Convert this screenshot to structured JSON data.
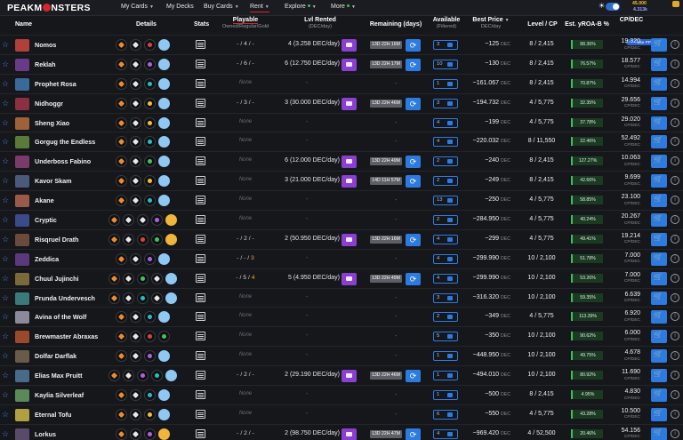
{
  "nav": {
    "logo_pre": "PEAKM",
    "logo_post": "NSTERS",
    "items": [
      "My Cards",
      "My Decks",
      "Buy Cards",
      "Rent",
      "Explore",
      "More"
    ],
    "balance_main": "45.000",
    "balance_sub": "4.313k",
    "use_pp": "Use PP"
  },
  "header": {
    "name": "Name",
    "details": "Details",
    "stats": "Stats",
    "playable": "Playable",
    "playable_sub": "Owned/Regular/Gold",
    "lvl_rented": "Lvl Rented",
    "lvl_rented_sub": "(DEC/day)",
    "remaining": "Remaining (days)",
    "available": "Available",
    "available_sub": "(Filtered)",
    "best_price": "Best Price",
    "best_price_sub": "DEC/day",
    "level_cp": "Level / CP",
    "yroa": "Est. yROA-B %",
    "cp_dec": "CP/DEC"
  },
  "colors": {
    "accent": "#2d7be0",
    "brand": "#d7262b",
    "purple": "#8a3fd0",
    "green": "#3fbf5b"
  },
  "rows": [
    {
      "name": "Nomos",
      "thumb": "#b0403a",
      "icons": [
        "orange",
        "white",
        "red",
        "sky"
      ],
      "playable": "- / 4 / -",
      "lvl": "4 (3.258 DEC/day)",
      "rem": "13D 22H 16M",
      "avail": "3",
      "price": "~125",
      "level_cp": "8 / 2,415",
      "roa": "88.36%",
      "cp": "19.320"
    },
    {
      "name": "Reklah",
      "thumb": "#6a3a8a",
      "icons": [
        "orange",
        "white",
        "purple",
        "sky"
      ],
      "playable": "- / 6 / -",
      "lvl": "6 (12.750 DEC/day)",
      "rem": "13D 22H 17M",
      "avail": "10",
      "price": "~130",
      "level_cp": "8 / 2,415",
      "roa": "76.57%",
      "cp": "18.577"
    },
    {
      "name": "Prophet Rosa",
      "thumb": "#3a6a9a",
      "icons": [
        "orange",
        "white",
        "teal",
        "sky"
      ],
      "playable": "None",
      "lvl": "-",
      "rem": "-",
      "avail": "1",
      "price": "~161.067",
      "level_cp": "8 / 2,415",
      "roa": "70.87%",
      "cp": "14.994"
    },
    {
      "name": "Nidhoggr",
      "thumb": "#8a3040",
      "icons": [
        "orange",
        "white",
        "yellow",
        "sky"
      ],
      "playable": "- / 3 / -",
      "lvl": "3 (30.000 DEC/day)",
      "rem": "13D 22H 46M",
      "avail": "3",
      "price": "~194.732",
      "level_cp": "4 / 5,775",
      "roa": "32.35%",
      "cp": "29.656"
    },
    {
      "name": "Sheng Xiao",
      "thumb": "#a0603a",
      "icons": [
        "orange",
        "white",
        "yellow",
        "sky"
      ],
      "playable": "None",
      "lvl": "-",
      "rem": "-",
      "avail": "4",
      "price": "~199",
      "level_cp": "4 / 5,775",
      "roa": "37.78%",
      "cp": "29.020"
    },
    {
      "name": "Gorgug the Endless",
      "thumb": "#5a7a3a",
      "icons": [
        "orange",
        "white",
        "teal",
        "sky"
      ],
      "playable": "None",
      "lvl": "-",
      "rem": "-",
      "avail": "4",
      "price": "~220.032",
      "level_cp": "8 / 11,550",
      "roa": "22.46%",
      "cp": "52.492"
    },
    {
      "name": "Underboss Fabino",
      "thumb": "#7a3a6a",
      "icons": [
        "orange",
        "white",
        "green",
        "sky"
      ],
      "playable": "None",
      "lvl": "6 (12.000 DEC/day)",
      "rem": "13D 22H 49M",
      "avail": "2",
      "price": "~240",
      "level_cp": "8 / 2,415",
      "roa": "127.27%",
      "cp": "10.063"
    },
    {
      "name": "Kavor Skam",
      "thumb": "#4a5a7a",
      "icons": [
        "orange",
        "white",
        "yellow",
        "sky"
      ],
      "playable": "None",
      "lvl": "3 (21.000 DEC/day)",
      "rem": "14D 11H 57M",
      "avail": "2",
      "price": "~249",
      "level_cp": "8 / 2,415",
      "roa": "42.66%",
      "cp": "9.699"
    },
    {
      "name": "Akane",
      "thumb": "#9a5a4a",
      "icons": [
        "orange",
        "white",
        "teal",
        "sky"
      ],
      "playable": "None",
      "lvl": "-",
      "rem": "-",
      "avail": "13",
      "price": "~250",
      "level_cp": "4 / 5,775",
      "roa": "58.85%",
      "cp": "23.100"
    },
    {
      "name": "Cryptic",
      "thumb": "#3a4a8a",
      "icons": [
        "orange",
        "white",
        "white",
        "purple",
        "gold"
      ],
      "playable": "None",
      "lvl": "-",
      "rem": "-",
      "avail": "2",
      "price": "~284.950",
      "level_cp": "4 / 5,775",
      "roa": "40.24%",
      "cp": "20.267"
    },
    {
      "name": "Risqruel Drath",
      "thumb": "#6a4a3a",
      "icons": [
        "orange",
        "white",
        "red",
        "green",
        "gold"
      ],
      "playable": "- / 2 / -",
      "lvl": "2 (50.950 DEC/day)",
      "rem": "13D 22H 16M",
      "avail": "4",
      "price": "~299",
      "level_cp": "4 / 5,775",
      "roa": "49.41%",
      "cp": "19.214"
    },
    {
      "name": "Zeddica",
      "thumb": "#5a3a7a",
      "icons": [
        "orange",
        "white",
        "purple",
        "sky"
      ],
      "playable": "- / - / 3",
      "lvl": "-",
      "rem": "-",
      "avail": "4",
      "price": "~299.990",
      "level_cp": "10 / 2,100",
      "roa": "51.78%",
      "cp": "7.000"
    },
    {
      "name": "Chuul Jujinchi",
      "thumb": "#7a6a3a",
      "icons": [
        "orange",
        "white",
        "green",
        "white",
        "sky"
      ],
      "playable": "- / 5 / 4",
      "lvl": "5 (4.950 DEC/day)",
      "rem": "13D 22H 49M",
      "avail": "4",
      "price": "~299.990",
      "level_cp": "10 / 2,100",
      "roa": "53.26%",
      "cp": "7.000"
    },
    {
      "name": "Prunda Undervesch",
      "thumb": "#3a7a7a",
      "icons": [
        "orange",
        "white",
        "teal",
        "white",
        "sky"
      ],
      "playable": "None",
      "lvl": "-",
      "rem": "-",
      "avail": "3",
      "price": "~316.320",
      "level_cp": "10 / 2,100",
      "roa": "59.35%",
      "cp": "6.639"
    },
    {
      "name": "Avina of the Wolf",
      "thumb": "#8a8a9a",
      "icons": [
        "orange",
        "white",
        "teal",
        "sky"
      ],
      "playable": "None",
      "lvl": "-",
      "rem": "-",
      "avail": "2",
      "price": "~349",
      "level_cp": "4 / 5,775",
      "roa": "113.39%",
      "cp": "6.920"
    },
    {
      "name": "Brewmaster Abraxas",
      "thumb": "#9a4a2a",
      "icons": [
        "orange",
        "white",
        "red",
        "green"
      ],
      "playable": "None",
      "lvl": "-",
      "rem": "-",
      "avail": "5",
      "price": "~350",
      "level_cp": "10 / 2,100",
      "roa": "90.62%",
      "cp": "6.000"
    },
    {
      "name": "Dolfar Darflak",
      "thumb": "#6a5a4a",
      "icons": [
        "orange",
        "white",
        "purple",
        "sky"
      ],
      "playable": "None",
      "lvl": "-",
      "rem": "-",
      "avail": "1",
      "price": "~448.950",
      "level_cp": "10 / 2,100",
      "roa": "49.75%",
      "cp": "4.678"
    },
    {
      "name": "Elias Max Pruitt",
      "thumb": "#4a6a8a",
      "icons": [
        "orange",
        "white",
        "purple",
        "teal",
        "sky"
      ],
      "playable": "- / 2 / -",
      "lvl": "2 (29.190 DEC/day)",
      "rem": "13D 22H 46M",
      "avail": "1",
      "price": "~494.010",
      "level_cp": "10 / 2,100",
      "roa": "80.92%",
      "cp": "11.690"
    },
    {
      "name": "Kaylia Silverleaf",
      "thumb": "#5a8a5a",
      "icons": [
        "orange",
        "white",
        "teal",
        "sky"
      ],
      "playable": "None",
      "lvl": "-",
      "rem": "-",
      "avail": "1",
      "price": "~500",
      "level_cp": "8 / 2,415",
      "roa": "4.95%",
      "cp": "4.830"
    },
    {
      "name": "Eternal Tofu",
      "thumb": "#b0a040",
      "icons": [
        "orange",
        "white",
        "yellow",
        "sky"
      ],
      "playable": "None",
      "lvl": "-",
      "rem": "-",
      "avail": "6",
      "price": "~550",
      "level_cp": "4 / 5,775",
      "roa": "43.28%",
      "cp": "10.500"
    },
    {
      "name": "Lorkus",
      "thumb": "#5a4a6a",
      "icons": [
        "orange",
        "white",
        "purple",
        "gold"
      ],
      "playable": "- / 2 / -",
      "lvl": "2 (98.750 DEC/day)",
      "rem": "13D 22H 47M",
      "avail": "4",
      "price": "~969.420",
      "level_cp": "4 / 52,500",
      "roa": "20.46%",
      "cp": "54.156"
    }
  ],
  "units": {
    "dec": "DEC",
    "cp_dec": "CP/DEC"
  }
}
